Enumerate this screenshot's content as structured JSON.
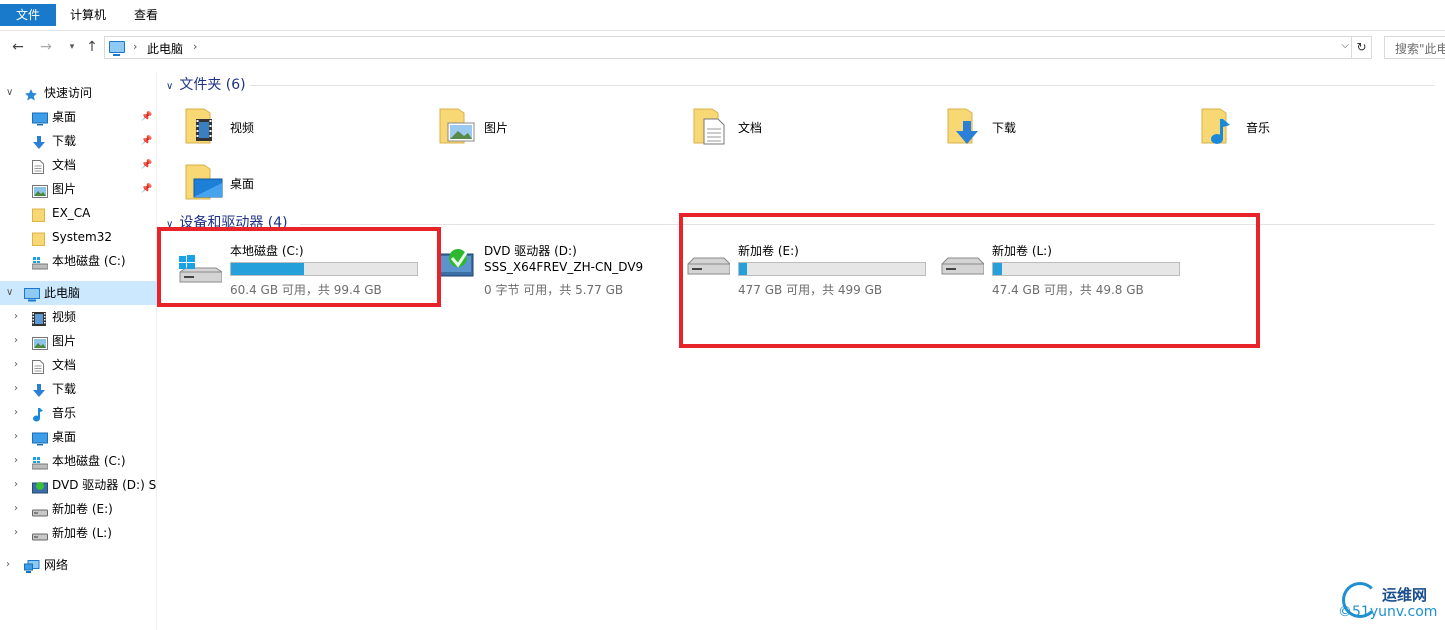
{
  "ribbon": {
    "tabs": [
      {
        "label": "文件"
      },
      {
        "label": "计算机"
      },
      {
        "label": "查看"
      }
    ]
  },
  "addressbar": {
    "crumb": "此电脑",
    "separator": "›",
    "search_placeholder": "搜索\"此电脑\""
  },
  "sidebar": {
    "quick_access": {
      "label": "快速访问"
    },
    "quick_items": [
      {
        "label": "桌面",
        "pinned": true
      },
      {
        "label": "下载",
        "pinned": true
      },
      {
        "label": "文档",
        "pinned": true
      },
      {
        "label": "图片",
        "pinned": true
      },
      {
        "label": "EX_CA"
      },
      {
        "label": "System32"
      },
      {
        "label": "本地磁盘 (C:)"
      }
    ],
    "this_pc": {
      "label": "此电脑"
    },
    "pc_items": [
      {
        "label": "视频"
      },
      {
        "label": "图片"
      },
      {
        "label": "文档"
      },
      {
        "label": "下载"
      },
      {
        "label": "音乐"
      },
      {
        "label": "桌面"
      },
      {
        "label": "本地磁盘 (C:)"
      },
      {
        "label": "DVD 驱动器 (D:) SS"
      },
      {
        "label": "新加卷 (E:)"
      },
      {
        "label": "新加卷 (L:)"
      }
    ],
    "network": {
      "label": "网络"
    }
  },
  "main": {
    "folders_header": "文件夹 (6)",
    "folders": [
      {
        "label": "视频"
      },
      {
        "label": "图片"
      },
      {
        "label": "文档"
      },
      {
        "label": "下载"
      },
      {
        "label": "音乐"
      },
      {
        "label": "桌面"
      }
    ],
    "drives_header": "设备和驱动器 (4)",
    "drives": [
      {
        "name": "本地磁盘 (C:)",
        "info": "60.4 GB 可用，共 99.4 GB",
        "used_fraction": 0.39
      },
      {
        "name": "DVD 驱动器 (D:)",
        "subtitle": "SSS_X64FREV_ZH-CN_DV9",
        "info": "0 字节 可用，共 5.77 GB"
      },
      {
        "name": "新加卷 (E:)",
        "info": "477 GB 可用，共 499 GB",
        "used_fraction": 0.045
      },
      {
        "name": "新加卷 (L:)",
        "info": "47.4 GB 可用，共 49.8 GB",
        "used_fraction": 0.05
      }
    ]
  },
  "watermark": {
    "cn": "运维网",
    "url": "©51yunv.com"
  },
  "colors": {
    "accent": "#1979ca",
    "selection": "#cce8ff",
    "progress": "#26a0da",
    "highlight": "#e8232a",
    "group_header": "#1e3287"
  }
}
